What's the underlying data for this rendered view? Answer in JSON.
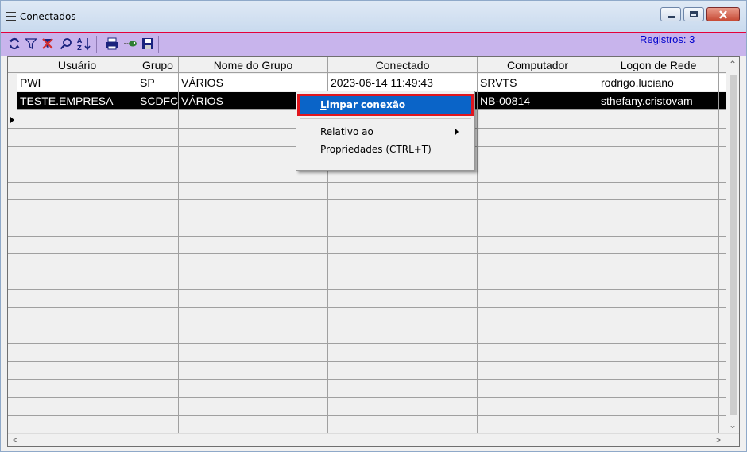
{
  "window": {
    "title": "Conectados"
  },
  "toolbar": {
    "icons": [
      "refresh-icon",
      "filter-icon",
      "clear-filter-icon",
      "find-icon",
      "sort-icon",
      "print-icon",
      "export-icon",
      "save-icon"
    ],
    "records_label": "Registros: 3"
  },
  "grid": {
    "columns": [
      "Usuário",
      "Grupo",
      "Nome do Grupo",
      "Conectado",
      "Computador",
      "Logon de Rede"
    ],
    "rows": [
      {
        "usuario": "PWI",
        "grupo": "SP",
        "nome_grupo": "VÁRIOS",
        "conectado": "2023-06-14 11:49:43",
        "computador": "SRVTS",
        "logon": "rodrigo.luciano",
        "selected": false
      },
      {
        "usuario": "TESTE.EMPRESA",
        "grupo": "SCDFC",
        "nome_grupo": "VÁRIOS",
        "conectado": "",
        "computador": "NB-00814",
        "logon": "sthefany.cristovam",
        "selected": true
      }
    ]
  },
  "context_menu": {
    "items": [
      {
        "label": "Limpar conexão",
        "active": true
      },
      {
        "label": "Relativo ao",
        "submenu": true
      },
      {
        "label": "Propriedades (CTRL+T)"
      }
    ]
  },
  "colors": {
    "toolbar_bg": "#c8b4ec",
    "selection_bg": "#000000",
    "menu_highlight": "#0a64c8",
    "highlight_outline": "#e0161e",
    "link": "#0000cc"
  }
}
